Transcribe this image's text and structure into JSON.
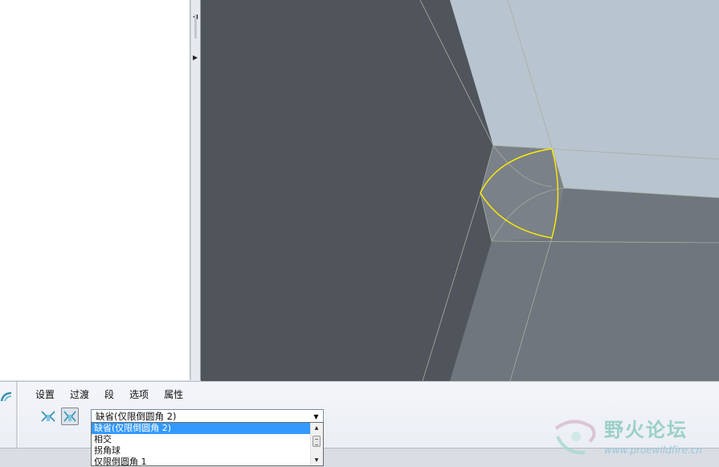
{
  "tabs": [
    "设置",
    "过渡",
    "段",
    "选项",
    "属性"
  ],
  "transition": {
    "selected": "缺省(仅限倒圆角 2)",
    "options": [
      "缺省(仅限倒圆角 2)",
      "相交",
      "拐角球",
      "仅限倒圆角 1"
    ]
  },
  "watermark": {
    "title": "野火论坛",
    "url": "www.proewildfire.cn"
  },
  "icons": {
    "dashboard_left": "fillet-feature-icon",
    "tool_1": "set-mode-icon",
    "tool_2": "transition-mode-icon",
    "combo_arrow": "chevron-down-icon"
  },
  "colors": {
    "viewport_bg": "#50555c",
    "face_top": "#b8c5d0",
    "face_front": "#6f767e",
    "fillet_highlight": "#ffee00",
    "selected_option": "#3399ff"
  }
}
